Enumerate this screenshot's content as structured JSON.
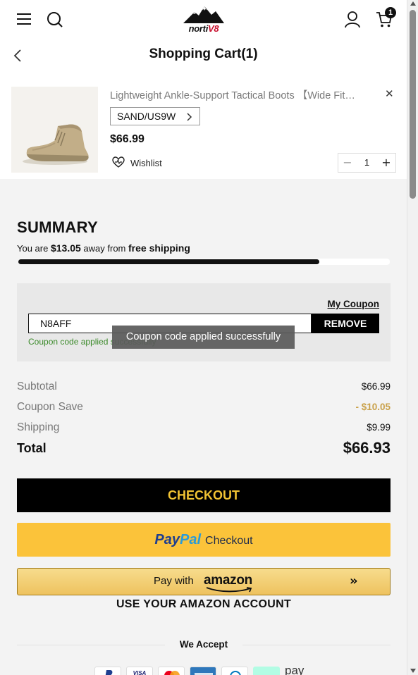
{
  "header": {
    "brand_prefix": "norti",
    "brand_suffix": "V8",
    "page_title": "Shopping Cart(1)",
    "cart_count": "1"
  },
  "cart_item": {
    "name": "Lightweight Ankle-Support Tactical Boots 【Wide Fit…",
    "variant": "SAND/US9W",
    "price": "$66.99",
    "wishlist_label": "Wishlist",
    "quantity": "1"
  },
  "summary": {
    "title": "SUMMARY",
    "shipping_msg_prefix": "You are",
    "shipping_amount": "$13.05",
    "shipping_msg_middle": "away from",
    "shipping_msg_bold": "free shipping",
    "free_shipping_progress": 0.81,
    "my_coupon_label": "My Coupon",
    "coupon_code": "N8AFF",
    "remove_label": "REMOVE",
    "coupon_success": "Coupon code applied successfully",
    "toast": "Coupon code applied successfully",
    "rows": [
      {
        "label": "Subtotal",
        "amount": "$66.99"
      },
      {
        "label": "Coupon Save",
        "amount": "- $10.05"
      },
      {
        "label": "Shipping",
        "amount": "$9.99"
      }
    ],
    "total_label": "Total",
    "total_amount": "$66.93"
  },
  "actions": {
    "checkout_label": "CHECKOUT",
    "paypal_pay": "Pay",
    "paypal_pal": "Pal",
    "paypal_checkout": "Checkout",
    "amazon_pay_with": "Pay with",
    "amazon_brand": "amazon",
    "amazon_sub": "USE YOUR AMAZON ACCOUNT"
  },
  "accept": {
    "title": "We Accept",
    "logos": [
      "paypal-icon",
      "visa-icon",
      "mastercard-icon",
      "amex-icon",
      "diners-icon",
      "afterpay-icon",
      "gpay-icon"
    ],
    "partial_text": "pay"
  },
  "colors": {
    "checkout_text": "#f0c233",
    "paypal_bg": "#fbc33a",
    "discount": "#c9a14a",
    "success": "#3b8a2a"
  }
}
